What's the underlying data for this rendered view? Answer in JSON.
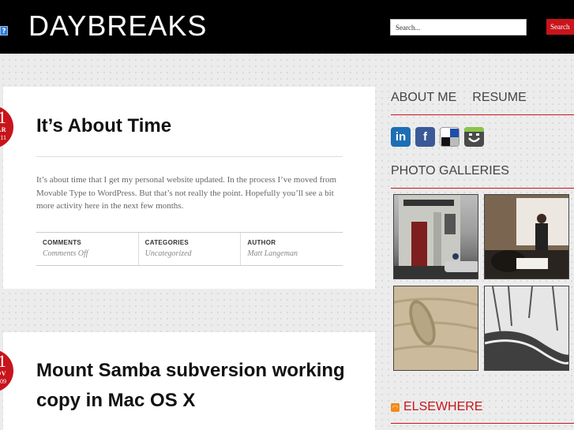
{
  "header": {
    "site_title": "DAYBREAKS",
    "search_placeholder": "Search...",
    "search_button": "Search",
    "help_icon_glyph": "?"
  },
  "posts": [
    {
      "date": {
        "day": "1",
        "month": "AR",
        "year": "11"
      },
      "title": "It’s About Time",
      "excerpt": "It’s about time that I get my personal website updated. In the process I’ve moved from Movable Type to WordPress. But that’s not really the point. Hopefully you’ll see a bit more activity here in the next few months.",
      "meta": {
        "comments_label": "COMMENTS",
        "comments_value": "Comments Off",
        "categories_label": "CATEGORIES",
        "categories_value": "Uncategorized",
        "author_label": "AUTHOR",
        "author_value": "Matt Langeman"
      }
    },
    {
      "date": {
        "day": "1",
        "month": "OV",
        "year": "09"
      },
      "title": "Mount Samba subversion working copy in Mac OS X"
    }
  ],
  "sidebar": {
    "nav": [
      "ABOUT ME",
      "RESUME"
    ],
    "social_icons": [
      "linkedin-icon",
      "facebook-icon",
      "delicious-icon",
      "smugmug-icon"
    ],
    "photo_galleries_heading": "PHOTO GALLERIES",
    "photos": [
      "zimbabwe-house-photo",
      "classroom-photo",
      "sand-footprint-photo",
      "snowy-creek-photo"
    ],
    "elsewhere_heading": "ELSEWHERE"
  },
  "colors": {
    "accent_red": "#c8141b",
    "header_bg": "#000000"
  }
}
